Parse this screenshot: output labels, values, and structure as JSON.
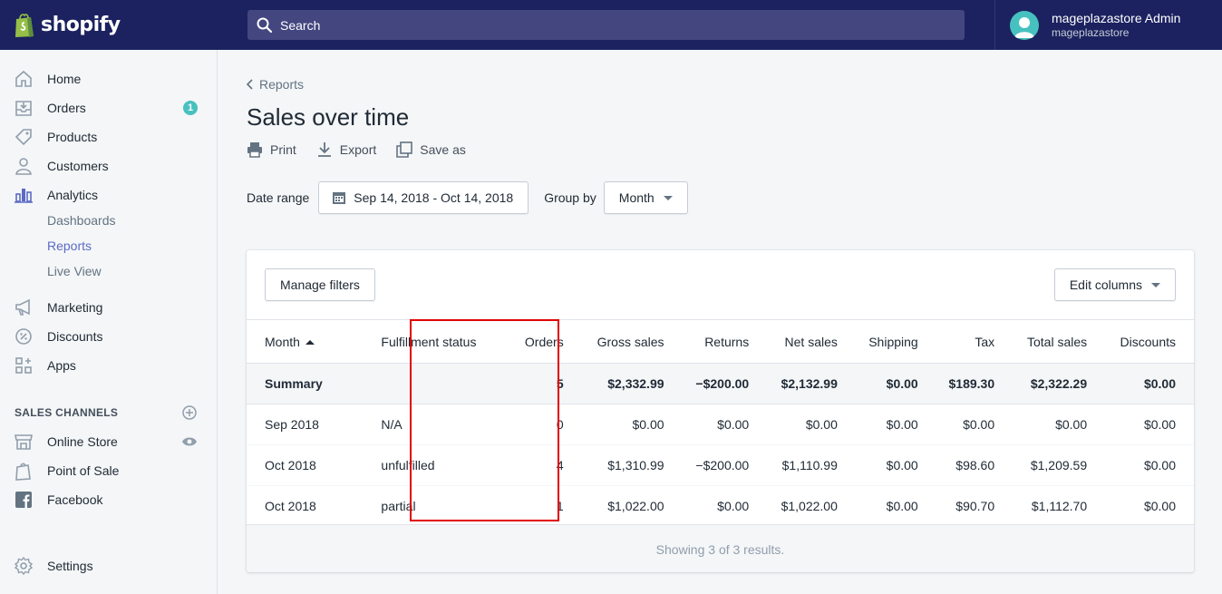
{
  "topbar": {
    "brand": "shopify",
    "search_placeholder": "Search",
    "account_name": "mageplazastore Admin",
    "account_store": "mageplazastore"
  },
  "sidebar": {
    "items": [
      {
        "label": "Home",
        "icon": "home-icon"
      },
      {
        "label": "Orders",
        "icon": "orders-icon",
        "badge": "1"
      },
      {
        "label": "Products",
        "icon": "tag-icon"
      },
      {
        "label": "Customers",
        "icon": "person-icon"
      },
      {
        "label": "Analytics",
        "icon": "bar-chart-icon"
      }
    ],
    "analytics_sub": [
      "Dashboards",
      "Reports",
      "Live View"
    ],
    "items2": [
      {
        "label": "Marketing",
        "icon": "megaphone-icon"
      },
      {
        "label": "Discounts",
        "icon": "discount-icon"
      },
      {
        "label": "Apps",
        "icon": "apps-icon"
      }
    ],
    "sales_channels_title": "SALES CHANNELS",
    "channels": [
      {
        "label": "Online Store",
        "icon": "store-icon"
      },
      {
        "label": "Point of Sale",
        "icon": "pos-bag-icon"
      },
      {
        "label": "Facebook",
        "icon": "facebook-icon"
      }
    ],
    "settings": "Settings"
  },
  "main": {
    "breadcrumb": "Reports",
    "title": "Sales over time",
    "actions": {
      "print": "Print",
      "export": "Export",
      "save_as": "Save as"
    },
    "date_range_label": "Date range",
    "date_range_value": "Sep 14, 2018 - Oct 14, 2018",
    "group_by_label": "Group by",
    "group_by_value": "Month"
  },
  "report": {
    "manage_filters": "Manage filters",
    "edit_columns": "Edit columns",
    "columns": [
      "Month",
      "Fulfillment status",
      "Orders",
      "Gross sales",
      "Returns",
      "Net sales",
      "Shipping",
      "Tax",
      "Total sales",
      "Discounts"
    ],
    "summary": [
      "Summary",
      "",
      "5",
      "$2,332.99",
      "−$200.00",
      "$2,132.99",
      "$0.00",
      "$189.30",
      "$2,322.29",
      "$0.00"
    ],
    "rows": [
      [
        "Sep 2018",
        "N/A",
        "0",
        "$0.00",
        "$0.00",
        "$0.00",
        "$0.00",
        "$0.00",
        "$0.00",
        "$0.00"
      ],
      [
        "Oct 2018",
        "unfulfilled",
        "4",
        "$1,310.99",
        "−$200.00",
        "$1,110.99",
        "$0.00",
        "$98.60",
        "$1,209.59",
        "$0.00"
      ],
      [
        "Oct 2018",
        "partial",
        "1",
        "$1,022.00",
        "$0.00",
        "$1,022.00",
        "$0.00",
        "$90.70",
        "$1,112.70",
        "$0.00"
      ]
    ],
    "footer": "Showing 3 of 3 results."
  },
  "colors": {
    "topbar": "#1c2260",
    "accent": "#5c6ac4",
    "badge": "#47c1bf",
    "highlight": "#e00000"
  }
}
